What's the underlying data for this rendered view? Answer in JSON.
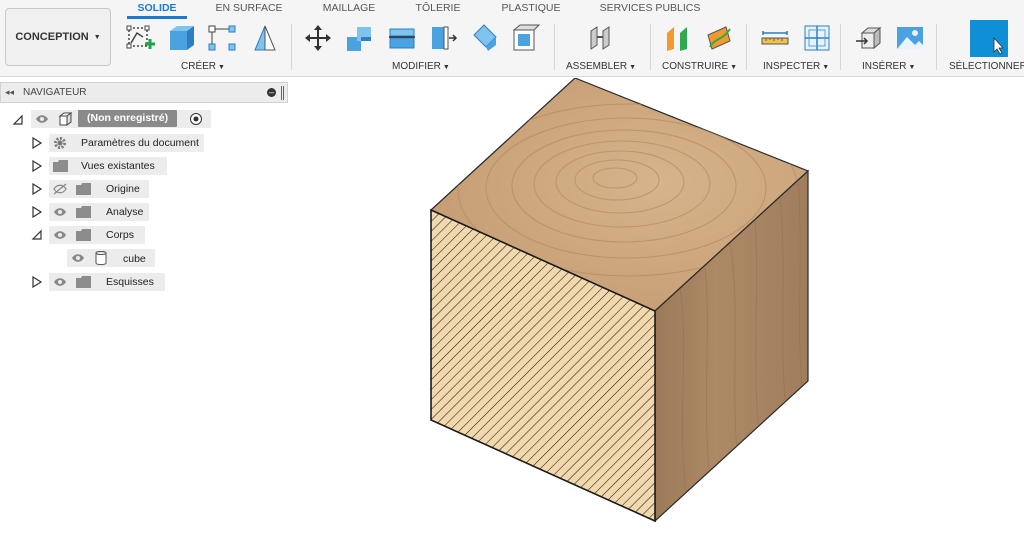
{
  "workspace": {
    "label": "CONCEPTION"
  },
  "tabs": [
    {
      "label": "SOLIDE",
      "active": true
    },
    {
      "label": "EN SURFACE",
      "active": false
    },
    {
      "label": "MAILLAGE",
      "active": false
    },
    {
      "label": "TÔLERIE",
      "active": false
    },
    {
      "label": "PLASTIQUE",
      "active": false
    },
    {
      "label": "SERVICES PUBLICS",
      "active": false
    }
  ],
  "groups": [
    {
      "label": "CRÉER",
      "tools": [
        "create-sketch-icon",
        "extrude-icon",
        "rectangle-pattern-icon",
        "revolve-icon"
      ]
    },
    {
      "label": "MODIFIER",
      "tools": [
        "move-icon",
        "combine-icon",
        "press-pull-icon",
        "fillet-icon",
        "split-icon",
        "shell-icon"
      ]
    },
    {
      "label": "ASSEMBLER",
      "tools": [
        "joint-icon"
      ]
    },
    {
      "label": "CONSTRUIRE",
      "tools": [
        "offset-plane-icon",
        "plane-along-path-icon"
      ]
    },
    {
      "label": "INSPECTER",
      "tools": [
        "measure-icon",
        "section-analysis-icon"
      ]
    },
    {
      "label": "INSÉRER",
      "tools": [
        "insert-derive-icon",
        "insert-image-icon"
      ]
    },
    {
      "label": "SÉLECTIONNER",
      "tools": [
        "select-icon"
      ]
    }
  ],
  "browser": {
    "title": "NAVIGATEUR",
    "root": {
      "label": "(Non enregistré)"
    },
    "items": [
      {
        "label": "Paramètres du document",
        "icon": "gear-icon",
        "expanded": false,
        "visible": null
      },
      {
        "label": "Vues existantes",
        "icon": "folder-icon",
        "expanded": false,
        "visible": null
      },
      {
        "label": "Origine",
        "icon": "folder-icon",
        "expanded": false,
        "visible": false
      },
      {
        "label": "Analyse",
        "icon": "folder-icon",
        "expanded": false,
        "visible": true
      },
      {
        "label": "Corps",
        "icon": "folder-icon",
        "expanded": true,
        "visible": true
      },
      {
        "label": "cube",
        "icon": "body-icon",
        "expanded": null,
        "visible": true
      },
      {
        "label": "Esquisses",
        "icon": "folder-icon",
        "expanded": false,
        "visible": true
      }
    ]
  },
  "colors": {
    "accent": "#1b7bd3",
    "select_button": "#0e8fd6",
    "wood_top": "#c9a27a",
    "wood_side": "#a88462",
    "hatch_face": "#f2d9ad"
  }
}
